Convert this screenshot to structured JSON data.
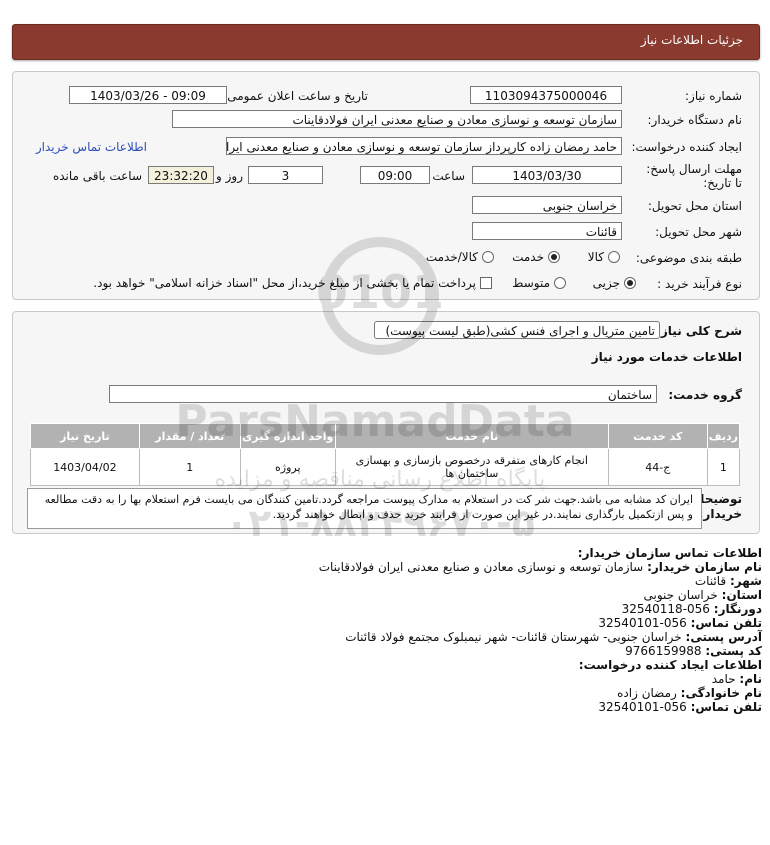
{
  "header": {
    "title": "جزئیات اطلاعات نیاز"
  },
  "form": {
    "need_number": {
      "label": "شماره نیاز:",
      "value": "1103094375000046"
    },
    "announce": {
      "label": "تاریخ و ساعت اعلان عمومی:",
      "value": "1403/03/26 - 09:09"
    },
    "buyer_org": {
      "label": "نام دستگاه خریدار:",
      "value": "سازمان توسعه و نوسازی معادن و صنایع معدنی ایران فولادقاینات"
    },
    "creator": {
      "label": "ایجاد کننده درخواست:",
      "value": "حامد  رمضان زاده  کارپرداز  سازمان توسعه و نوسازی معادن و صنایع معدنی ایرا",
      "contact_link": "اطلاعات تماس خریدار"
    },
    "deadline": {
      "label": "مهلت ارسال پاسخ: تا تاریخ:",
      "date": "1403/03/30",
      "time_label": "ساعت",
      "time": "09:00",
      "days": "3",
      "days_label": "روز و",
      "remaining": "23:32:20",
      "remaining_label": "ساعت باقی مانده"
    },
    "province": {
      "label": "استان محل تحویل:",
      "value": "خراسان جنوبی"
    },
    "city": {
      "label": "شهر محل تحویل:",
      "value": "قائنات"
    },
    "category": {
      "label": "طبقه بندی موضوعی:",
      "options": [
        "کالا",
        "خدمت",
        "کالا/خدمت"
      ],
      "selected": "خدمت"
    },
    "process": {
      "label": "نوع فرآیند خرید :",
      "options": [
        "جزیی",
        "متوسط"
      ],
      "selected": "جزیی",
      "payment_note": "پرداخت تمام یا بخشی از مبلغ خرید،از محل \"اسناد خزانه اسلامی\" خواهد بود."
    }
  },
  "details": {
    "summary_label": "شرح کلی نیاز:",
    "summary": "تامین متریال و اجرای فنس کشی(طبق لیست پیوست)",
    "services_title": "اطلاعات خدمات مورد نیاز",
    "group_label": "گروه خدمت:",
    "group": "ساختمان",
    "table": {
      "headers": [
        "ردیف",
        "کد خدمت",
        "نام خدمت",
        "واحد اندازه گیری",
        "تعداد / مقدار",
        "تاریخ نیاز"
      ],
      "rows": [
        [
          "1",
          "ج-44",
          "انجام کارهای متفرقه درخصوص بازسازی و بهسازی ساختمان ها",
          "پروژه",
          "1",
          "1403/04/02"
        ]
      ]
    },
    "notes_label": "توضیحات خریدار:",
    "notes": "ایران کد مشابه می باشد.جهت شر کت در استعلام به مدارک پیوست مراجعه گردد.تامین کنندگان می بایست فرم استعلام بها را به دقت مطالعه و پس ازتکمیل بارگذاری نمایند.در غیر این صورت از فرایند خرید حذف و ابطال خواهند گردید."
  },
  "contact": {
    "title": "اطلاعات تماس سازمان خریدار:",
    "org_label": "نام سازمان خریدار:",
    "org": "سازمان توسعه و نوسازی معادن و صنایع معدنی ایران فولادقاینات",
    "city_label": "شهر:",
    "city": "قائنات",
    "province_label": "استان:",
    "province": "خراسان جنوبی",
    "fax_label": "دورنگار:",
    "fax": "056-32540118",
    "phone_label": "تلفن تماس:",
    "phone": "056-32540101",
    "address_label": "آدرس پستی:",
    "address": "خراسان جنوبی- شهرستان قائنات- شهر نیمبلوک مجتمع فولاد قائنات",
    "postal_label": "کد پستی:",
    "postal": "9766159988",
    "creator_title": "اطلاعات ایجاد کننده درخواست:",
    "first_name_label": "نام:",
    "first_name": "حامد",
    "last_name_label": "نام خانوادگی:",
    "last_name": "رمضان زاده",
    "creator_phone_label": "تلفن تماس:",
    "creator_phone": "056-32540101"
  },
  "watermark": {
    "line1": "ParsNamadData",
    "line2": "پایگاه اطلاع رسانی مناقصه و مزایده",
    "line3": "۰۲۱-۸۸۳۴۹۶۷۰-۵"
  }
}
